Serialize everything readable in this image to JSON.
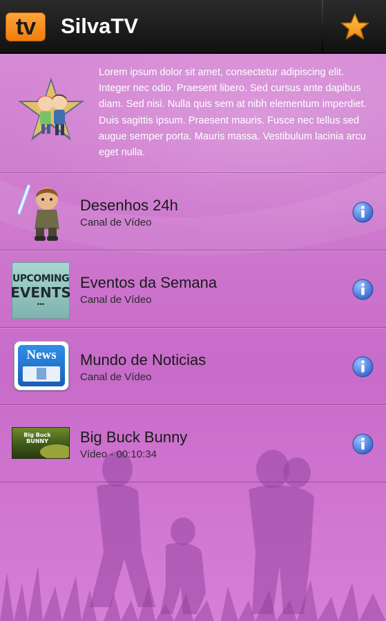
{
  "header": {
    "logo_text": "tv",
    "title": "SilvaTV",
    "favorite_icon": "star-icon"
  },
  "intro": {
    "avatar_icon": "couple-star-avatar",
    "text": "Lorem ipsum dolor sit amet, consectetur adipiscing elit. Integer nec odio. Praesent libero. Sed cursus ante dapibus diam. Sed nisi. Nulla quis sem at nibh elementum imperdiet. Duis sagittis ipsum. Praesent mauris. Fusce nec tellus sed augue semper porta. Mauris massa. Vestibulum lacinia arcu eget nulla."
  },
  "items": [
    {
      "title": "Desenhos 24h",
      "subtitle": "Canal de Vídeo",
      "thumb": "cartoon-jedi-thumb"
    },
    {
      "title": "Eventos da Semana",
      "subtitle": "Canal de Vídeo",
      "thumb": "upcoming-events-thumb",
      "thumb_lines": [
        "UPCOMING",
        "EVENTS",
        "•••"
      ]
    },
    {
      "title": "Mundo de Noticias",
      "subtitle": "Canal de Vídeo",
      "thumb": "news-icon-thumb",
      "thumb_label": "News"
    },
    {
      "title": "Big Buck Bunny",
      "subtitle": "Vídeo - 00:10:34",
      "thumb": "big-buck-bunny-thumb",
      "thumb_label": "Big Buck BUNNY"
    }
  ],
  "colors": {
    "header_bg": "#1a1a1a",
    "logo_orange": "#f58a1f",
    "star": "#f6a623",
    "background_pink": "#cf7ccf",
    "info_blue": "#3f6fd0"
  }
}
